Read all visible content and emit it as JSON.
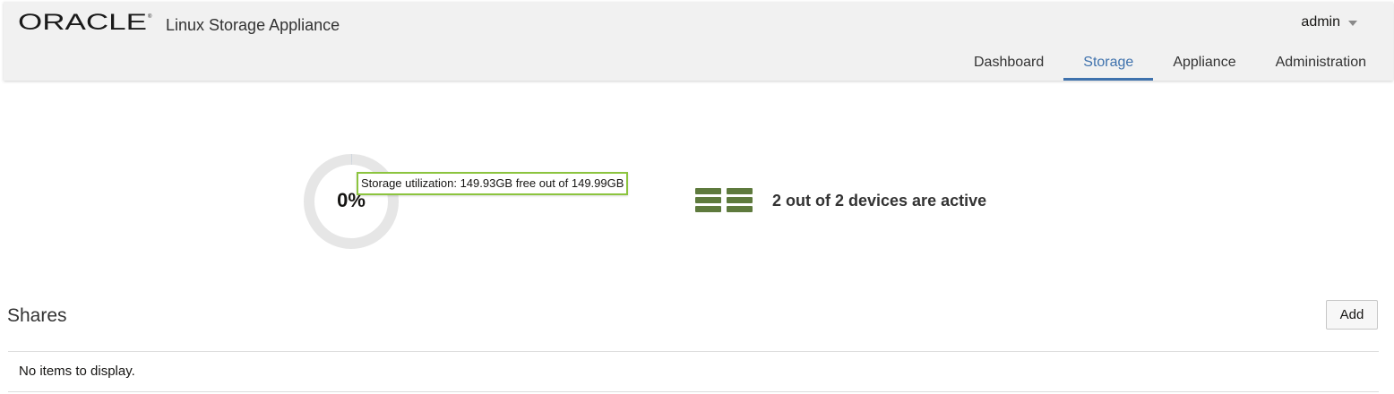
{
  "header": {
    "logo_text": "ORACLE",
    "app_title": "Linux Storage Appliance",
    "user": {
      "name": "admin",
      "menu_icon": "caret-down-icon"
    },
    "tabs": [
      {
        "label": "Dashboard",
        "active": false
      },
      {
        "label": "Storage",
        "active": true
      },
      {
        "label": "Appliance",
        "active": false
      },
      {
        "label": "Administration",
        "active": false
      }
    ],
    "accent_color": "#3f72ad"
  },
  "summary": {
    "utilization": {
      "percent_label": "0%",
      "used_fraction": 0.0004,
      "tooltip": "Storage utilization: 149.93GB free out of 149.99GB",
      "ring_color": "#e6e6e6",
      "tooltip_border_color": "#8cc43f"
    },
    "devices": {
      "icon": "storage-devices-icon",
      "status_text": "2 out of 2 devices are active",
      "icon_color": "#5e7a3d"
    }
  },
  "shares": {
    "title": "Shares",
    "add_label": "Add",
    "empty_message": "No items to display."
  }
}
